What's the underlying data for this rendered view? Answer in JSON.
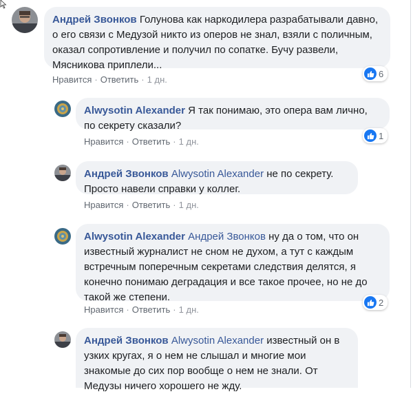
{
  "actions_labels": {
    "like": "Нравится",
    "reply": "Ответить"
  },
  "comments": [
    {
      "author": "Андрей Звонков",
      "mention": "",
      "text": "Голунова как наркодилера разрабатывали давно, о его связи с Медузой никто из оперов не знал, взяли с поличным, оказал сопротивление и получил по сопатке. Бучу развели, Мясникова приплели...",
      "age": "1 дн.",
      "reactions": "6"
    },
    {
      "author": "Alwysotin Alexander",
      "mention": "",
      "text": "Я так понимаю, это опера вам лично, по секрету сказали?",
      "age": "1 дн.",
      "reactions": "1"
    },
    {
      "author": "Андрей Звонков",
      "mention": "Alwysotin Alexander",
      "text": "не по секрету. Просто навели справки у коллег.",
      "age": "1 дн.",
      "reactions": ""
    },
    {
      "author": "Alwysotin Alexander",
      "mention": "Андрей Звонков",
      "text": "ну да о том, что он известный журналист не сном не духом, а тут с каждым встречным поперечным секретами следствия делятся, я конечно понимаю деградация и все такое прочее, но не до такой же степени.",
      "age": "1 дн.",
      "reactions": "2"
    },
    {
      "author": "Андрей Звонков",
      "mention": "Alwysotin Alexander",
      "text": "известный он в узких кругах, я о нем не слышал и многие мои знакомые до сих пор вообще о нем не знали. От Медузы ничего хорошего не жду.",
      "age": "",
      "reactions": ""
    }
  ]
}
